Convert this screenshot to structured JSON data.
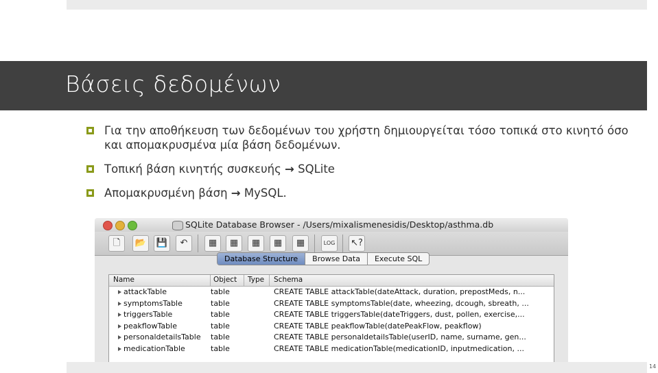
{
  "slide": {
    "title": "Βάσεις δεδομένων",
    "page_number": "14",
    "bullets": [
      {
        "text": "Για την αποθήκευση των δεδομένων του χρήστη δημιουργείται τόσο τοπικά στο κινητό όσο και απομακρυσμένα μία βάση δεδομένων."
      },
      {
        "text_before": "Τοπική βάση κινητής συσκευής ",
        "arrow": "→",
        "text_after": " SQLite"
      },
      {
        "text_before": "Απομακρυσμένη βάση ",
        "arrow": "→",
        "text_after": " MySQL."
      }
    ],
    "accent_color": "#8a9a1a",
    "title_bar_color": "#404040"
  },
  "screenshot": {
    "window_title": "SQLite Database Browser - /Users/mixalismenesidis/Desktop/asthma.db",
    "toolbar_icons": [
      "new-database-icon",
      "open-database-icon",
      "save-icon",
      "undo-icon",
      "create-table-icon",
      "delete-table-icon",
      "modify-table-icon",
      "create-index-icon",
      "delete-index-icon",
      "log-icon",
      "whats-this-icon"
    ],
    "tabs": [
      "Database Structure",
      "Browse Data",
      "Execute SQL"
    ],
    "active_tab": "Database Structure",
    "columns": [
      "Name",
      "Object",
      "Type",
      "Schema"
    ],
    "rows": [
      {
        "name": "attackTable",
        "object": "table",
        "type": "",
        "schema": "CREATE TABLE attackTable(dateAttack, duration, prepostMeds, n..."
      },
      {
        "name": "symptomsTable",
        "object": "table",
        "type": "",
        "schema": "CREATE TABLE symptomsTable(date, wheezing, dcough, sbreath, ..."
      },
      {
        "name": "triggersTable",
        "object": "table",
        "type": "",
        "schema": "CREATE TABLE triggersTable(dateTriggers, dust, pollen, exercise,..."
      },
      {
        "name": "peakflowTable",
        "object": "table",
        "type": "",
        "schema": "CREATE TABLE peakflowTable(datePeakFlow, peakflow)"
      },
      {
        "name": "personaldetailsTable",
        "object": "table",
        "type": "",
        "schema": "CREATE TABLE personaldetailsTable(userID, name, surname, gen..."
      },
      {
        "name": "medicationTable",
        "object": "table",
        "type": "",
        "schema": "CREATE TABLE medicationTable(medicationID, inputmedication, ..."
      }
    ]
  }
}
